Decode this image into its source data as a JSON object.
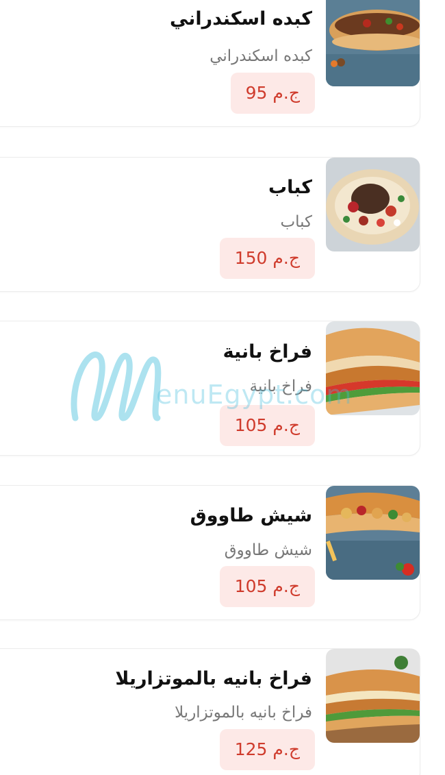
{
  "menu": {
    "items": [
      {
        "title": "كبده اسكندراني",
        "description": "كبده اسكندراني",
        "price": "95",
        "currency": "ج.م"
      },
      {
        "title": "كباب",
        "description": "كباب",
        "price": "150",
        "currency": "ج.م"
      },
      {
        "title": "فراخ بانية",
        "description": "فراخ بانية",
        "price": "105",
        "currency": "ج.م"
      },
      {
        "title": "شيش طاووق",
        "description": "شيش طاووق",
        "price": "105",
        "currency": "ج.م"
      },
      {
        "title": "فراخ بانيه بالموتزاريلا",
        "description": "فراخ بانيه بالموتزاريلا",
        "price": "125",
        "currency": "ج.م"
      }
    ]
  },
  "watermark": {
    "text": "enuEgypt.com"
  },
  "colors": {
    "price_text": "#cf3b2c",
    "price_bg": "#fde9e7",
    "watermark": "#46bedc"
  }
}
